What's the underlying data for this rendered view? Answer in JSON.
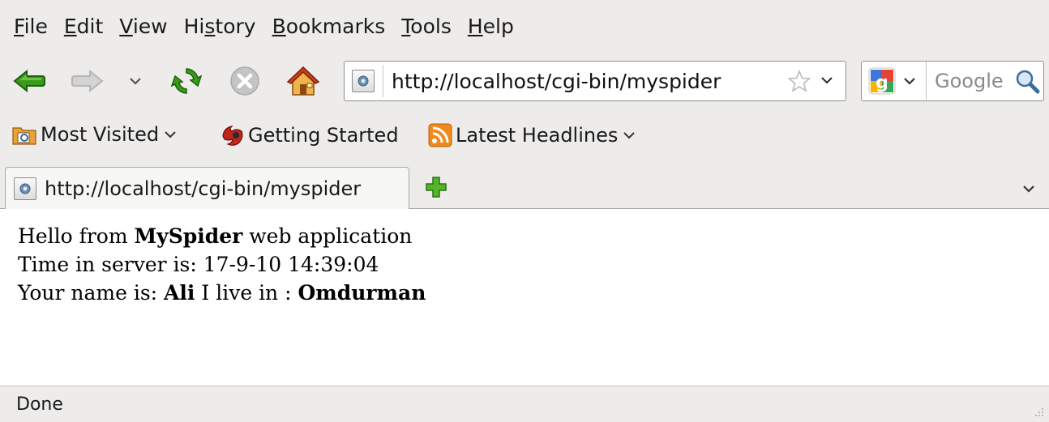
{
  "menu": [
    {
      "acc": "F",
      "rest": "ile"
    },
    {
      "acc": "E",
      "rest": "dit"
    },
    {
      "acc": "V",
      "rest": "iew"
    },
    {
      "pre": "Hi",
      "acc": "s",
      "rest": "tory"
    },
    {
      "acc": "B",
      "rest": "ookmarks"
    },
    {
      "acc": "T",
      "rest": "ools"
    },
    {
      "acc": "H",
      "rest": "elp"
    }
  ],
  "navbar": {
    "icons": [
      "back-icon",
      "forward-icon",
      "history-dropdown-icon",
      "reload-icon",
      "stop-icon",
      "home-icon"
    ],
    "url": "http://localhost/cgi-bin/myspider",
    "search_placeholder": "Google"
  },
  "bookmarks": {
    "most_visited": "Most Visited",
    "getting_started": "Getting Started",
    "latest_headlines": "Latest Headlines"
  },
  "tab": {
    "title": "http://localhost/cgi-bin/myspider"
  },
  "content": {
    "line1_pre": "Hello from ",
    "line1_bold": "MySpider",
    "line1_post": " web application",
    "line2": "Time in server is: 17-9-10 14:39:04",
    "line3_pre": "Your name is: ",
    "name": "Ali",
    "line3_mid": " I live in : ",
    "city": "Omdurman"
  },
  "status": {
    "text": "Done"
  },
  "colors": {
    "chrome_bg": "#edeceb",
    "arrow_green": "#3a9a1a",
    "stop_gray": "#b9b9b9",
    "rss_orange": "#f08a1c"
  }
}
